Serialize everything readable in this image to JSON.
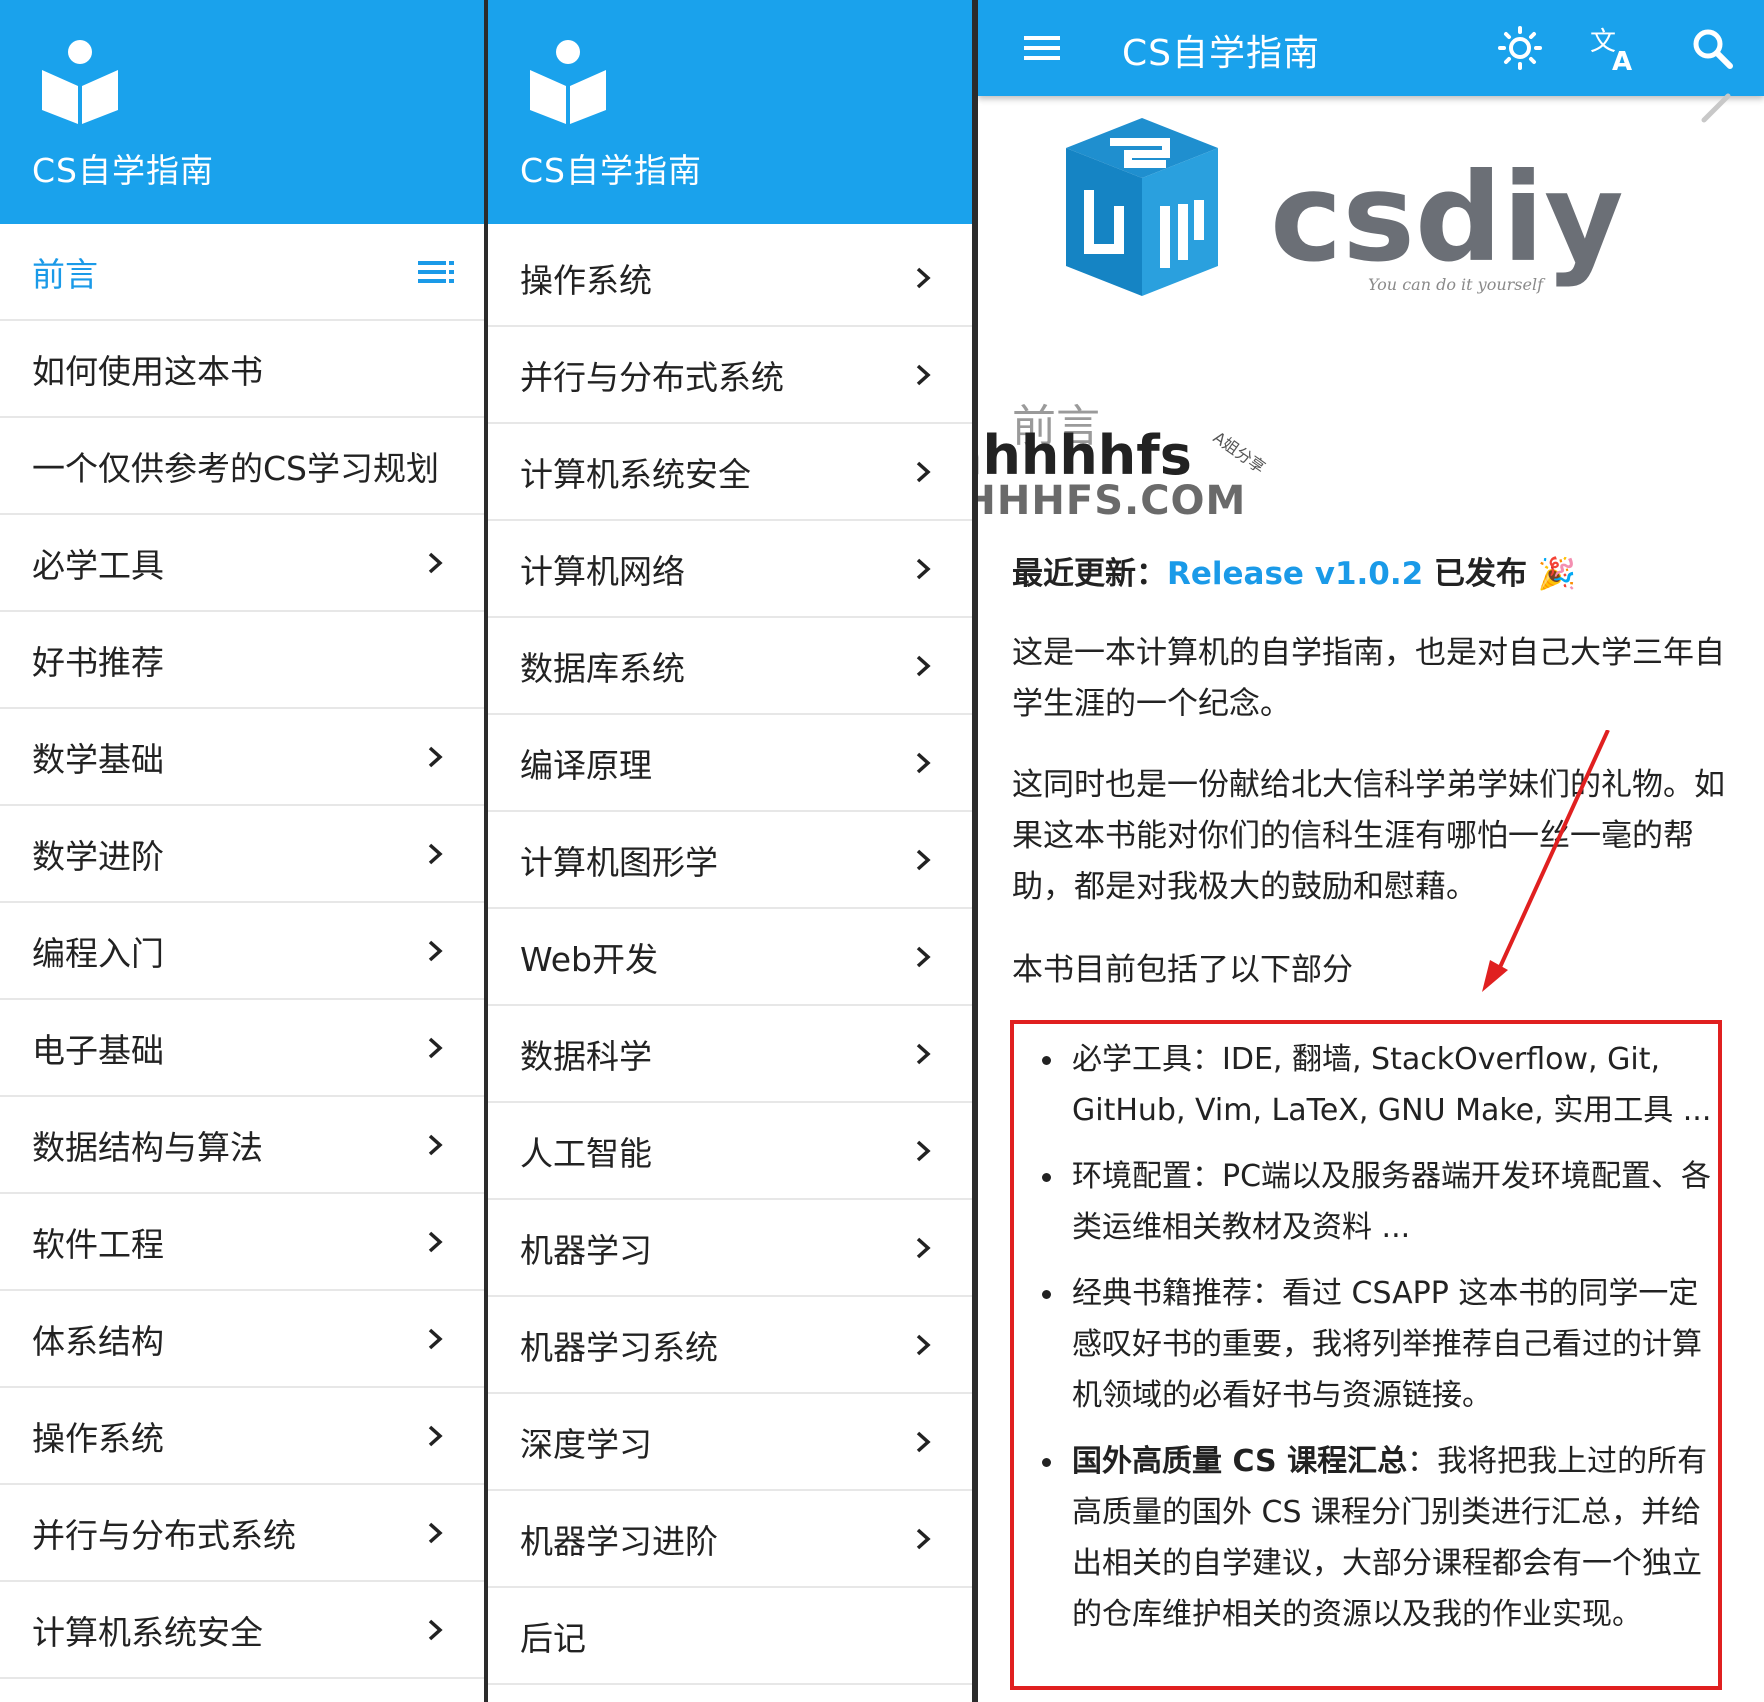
{
  "panel1": {
    "title": "CS自学指南",
    "items": [
      {
        "label": "前言",
        "active": true,
        "icon": "toc-icon"
      },
      {
        "label": "如何使用这本书",
        "chevron": false
      },
      {
        "label": "一个仅供参考的CS学习规划",
        "chevron": false
      },
      {
        "label": "必学工具",
        "chevron": true
      },
      {
        "label": "好书推荐",
        "chevron": false
      },
      {
        "label": "数学基础",
        "chevron": true
      },
      {
        "label": "数学进阶",
        "chevron": true
      },
      {
        "label": "编程入门",
        "chevron": true
      },
      {
        "label": "电子基础",
        "chevron": true
      },
      {
        "label": "数据结构与算法",
        "chevron": true
      },
      {
        "label": "软件工程",
        "chevron": true
      },
      {
        "label": "体系结构",
        "chevron": true
      },
      {
        "label": "操作系统",
        "chevron": true
      },
      {
        "label": "并行与分布式系统",
        "chevron": true
      },
      {
        "label": "计算机系统安全",
        "chevron": true
      }
    ]
  },
  "panel2": {
    "title": "CS自学指南",
    "items": [
      {
        "label": "操作系统",
        "chevron": true
      },
      {
        "label": "并行与分布式系统",
        "chevron": true
      },
      {
        "label": "计算机系统安全",
        "chevron": true
      },
      {
        "label": "计算机网络",
        "chevron": true
      },
      {
        "label": "数据库系统",
        "chevron": true
      },
      {
        "label": "编译原理",
        "chevron": true
      },
      {
        "label": "计算机图形学",
        "chevron": true
      },
      {
        "label": "Web开发",
        "chevron": true
      },
      {
        "label": "数据科学",
        "chevron": true
      },
      {
        "label": "人工智能",
        "chevron": true
      },
      {
        "label": "机器学习",
        "chevron": true
      },
      {
        "label": "机器学习系统",
        "chevron": true
      },
      {
        "label": "深度学习",
        "chevron": true
      },
      {
        "label": "机器学习进阶",
        "chevron": true
      },
      {
        "label": "后记",
        "chevron": false
      }
    ]
  },
  "panel3": {
    "appbar": {
      "title": "CS自学指南",
      "icons": [
        "menu-icon",
        "brightness-icon",
        "translate-icon",
        "search-icon"
      ]
    },
    "logo": {
      "text": "csdiy",
      "tagline": "You can do it yourself"
    },
    "heading": "前言",
    "watermark": {
      "brand": "ahhhhfs",
      "tag": "A姐分享",
      "site": "AHHHHFS.COM"
    },
    "update": {
      "label": "最近更新：",
      "link": "Release v1.0.2",
      "suffix": "已发布",
      "emoji": "🎉"
    },
    "para1": "这是一本计算机的自学指南，也是对自己大学三年自学生涯的一个纪念。",
    "para2": "这同时也是一份献给北大信科学弟学妹们的礼物。如果这本书能对你们的信科生涯有哪怕一丝一毫的帮助，都是对我极大的鼓励和慰藉。",
    "para3": "本书目前包括了以下部分",
    "bullets": [
      {
        "title": "必学工具",
        "sep": "：",
        "text": "IDE, 翻墙, StackOverflow, Git, GitHub, Vim, LaTeX, GNU Make, 实用工具 ..."
      },
      {
        "title": "环境配置",
        "sep": "：",
        "text": "PC端以及服务器端开发环境配置、各类运维相关教材及资料 ..."
      },
      {
        "title": "经典书籍推荐",
        "sep": "：",
        "text": "看过 CSAPP 这本书的同学一定感叹好书的重要，我将列举推荐自己看过的计算机领域的必看好书与资源链接。"
      },
      {
        "title": "国外高质量 CS 课程汇总",
        "sep": "：",
        "text": "我将把我上过的所有高质量的国外 CS 课程分门别类进行汇总，并给出相关的自学建议，大部分课程都会有一个独立的仓库维护相关的资源以及我的作业实现。",
        "bold": true
      }
    ]
  },
  "colors": {
    "primary": "#1aa2ec",
    "link": "#1a9ae8",
    "annotation": "#e02020",
    "logo_blue": "#1f8fcf",
    "logo_gray": "#6b6f76"
  }
}
